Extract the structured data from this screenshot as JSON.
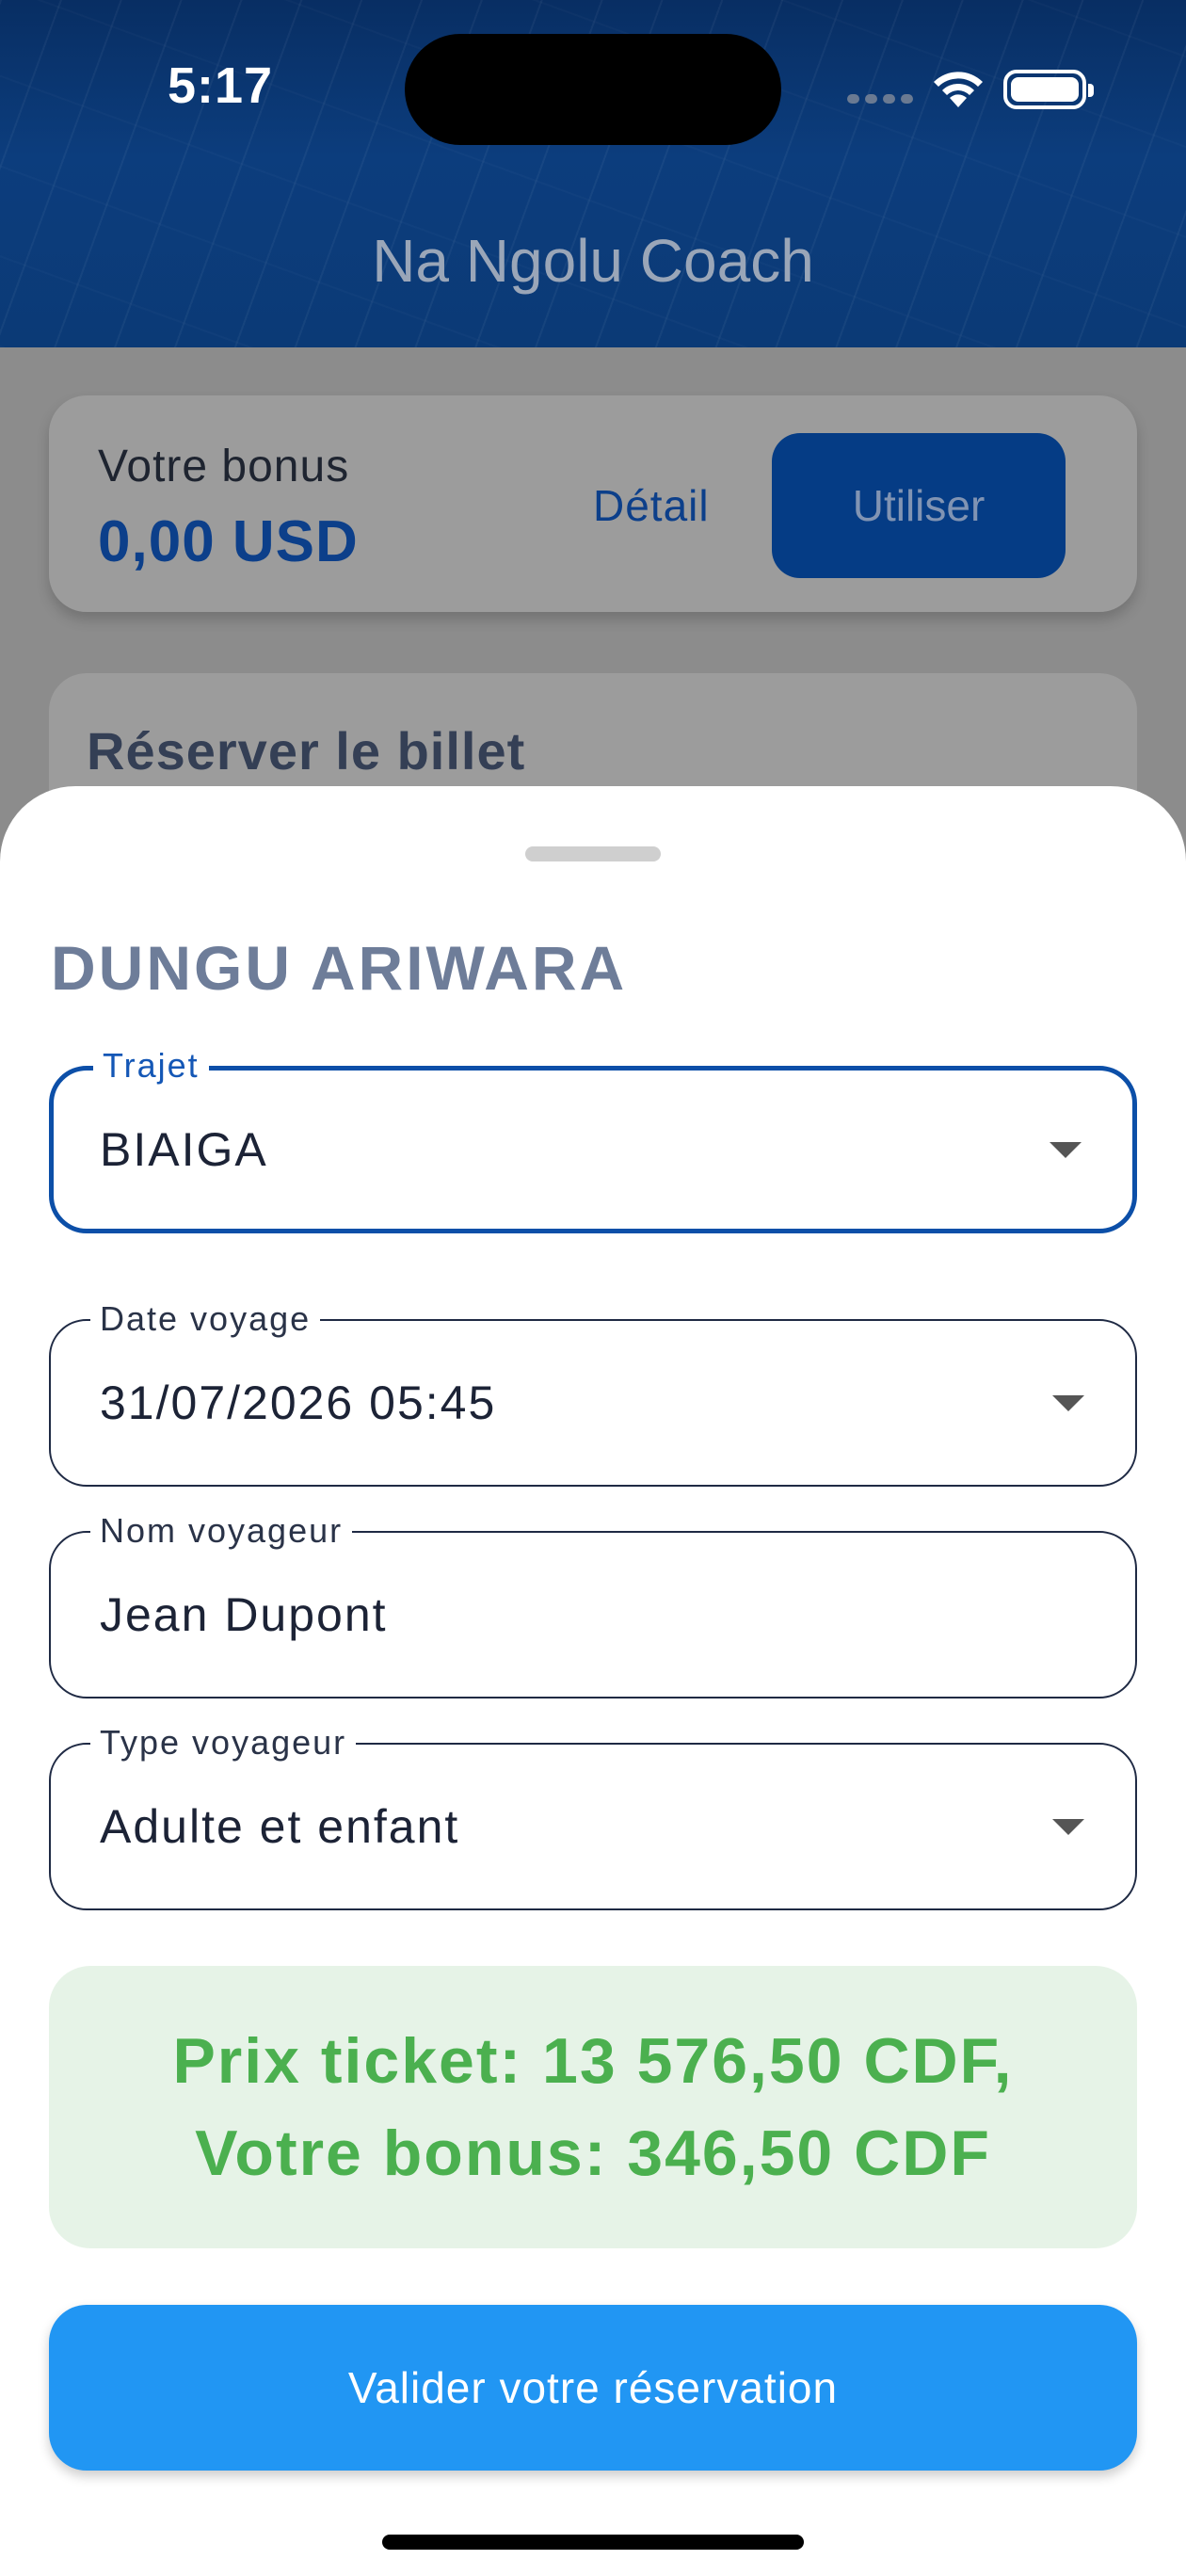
{
  "status_bar": {
    "time": "5:17",
    "icons": [
      "signal-icon",
      "wifi-icon",
      "battery-icon"
    ]
  },
  "header": {
    "title": "Na Ngolu Coach"
  },
  "bonus_card": {
    "label": "Votre bonus",
    "value": "0,00 USD",
    "detail_label": "Détail",
    "use_label": "Utiliser"
  },
  "reserve_card": {
    "title": "Réserver le billet"
  },
  "sheet": {
    "title": "DUNGU ARIWARA",
    "fields": [
      {
        "label": "Trajet",
        "value": "BIAIGA",
        "type": "dropdown",
        "focused": true
      },
      {
        "label": "Date voyage",
        "value": "31/07/2026 05:45",
        "type": "dropdown"
      },
      {
        "label": "Nom voyageur",
        "value": "Jean Dupont",
        "type": "text"
      },
      {
        "label": "Type voyageur",
        "value": "Adulte et enfant",
        "type": "dropdown"
      }
    ],
    "price_line1": "Prix ticket: 13 576,50 CDF,",
    "price_line2": "Votre bonus: 346,50 CDF",
    "submit_label": "Valider votre réservation"
  },
  "colors": {
    "primary": "#0c4fa8",
    "button": "#2196f3",
    "price_text": "#4bb04f",
    "price_bg": "#e6f3e7",
    "header": "#0b3a76"
  }
}
